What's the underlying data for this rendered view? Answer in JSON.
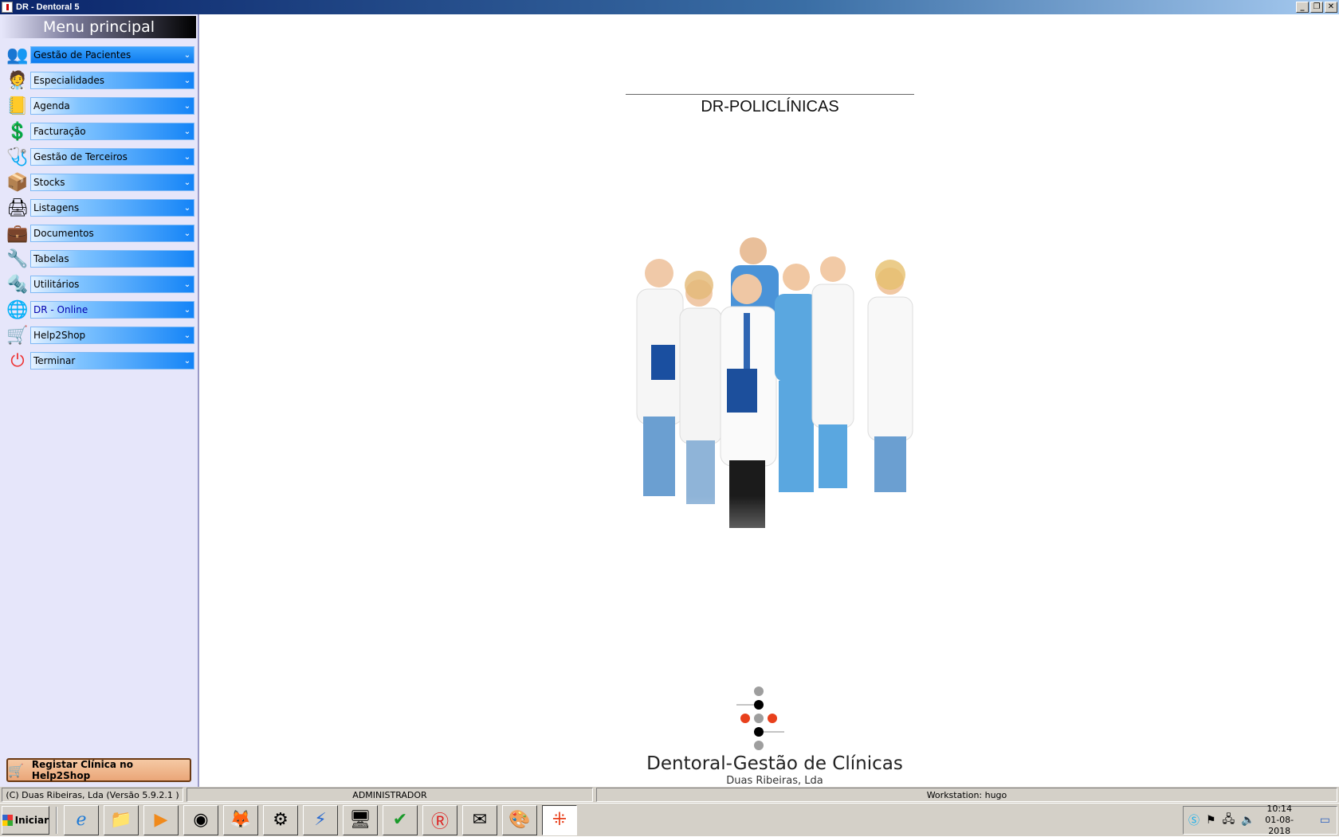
{
  "window": {
    "title": "DR - Dentoral 5"
  },
  "sidebar": {
    "title": "Menu principal",
    "items": [
      {
        "label": "Gestão de Pacientes",
        "icon": "patients-icon"
      },
      {
        "label": "Especialidades",
        "icon": "specialist-icon"
      },
      {
        "label": "Agenda",
        "icon": "agenda-book-icon"
      },
      {
        "label": "Facturação",
        "icon": "dollar-icon"
      },
      {
        "label": "Gestão de Terceiros",
        "icon": "third-party-icon"
      },
      {
        "label": "Stocks",
        "icon": "stock-box-icon"
      },
      {
        "label": "Listagens",
        "icon": "printer-icon"
      },
      {
        "label": "Documentos",
        "icon": "briefcase-icon"
      },
      {
        "label": "Tabelas",
        "icon": "tools-icon"
      },
      {
        "label": "Utilitários",
        "icon": "wrench-icon"
      },
      {
        "label": "DR - Online",
        "icon": "globe-icon"
      },
      {
        "label": "Help2Shop",
        "icon": "help2shop-icon"
      },
      {
        "label": "Terminar",
        "icon": "power-icon"
      }
    ],
    "register_button": "Registar Clínica no Help2Shop"
  },
  "main": {
    "clinic_name": "DR-POLICLÍNICAS",
    "brand": "Dentoral-Gestão de Clínicas",
    "brand_sub": "Duas Ribeiras, Lda"
  },
  "statusbar": {
    "copyright": "(C) Duas Ribeiras, Lda (Versão 5.9.2.1 )",
    "user": "ADMINISTRADOR",
    "workstation": "Workstation: hugo"
  },
  "taskbar": {
    "start_label": "Iniciar",
    "clock_time": "10:14",
    "clock_date": "01-08-2018"
  },
  "colors": {
    "menu_bar": "#0d7bef",
    "sidebar_bg": "#e6e6fa",
    "logo_red": "#e8401c"
  }
}
